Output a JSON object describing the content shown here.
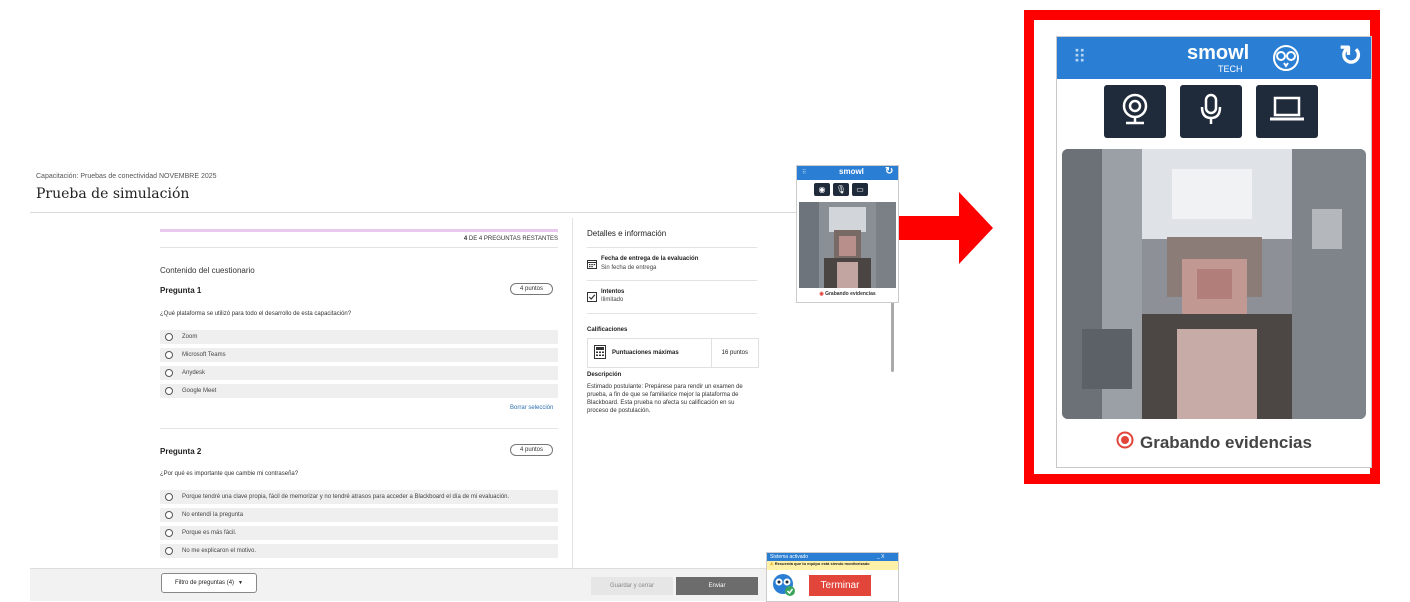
{
  "page": {
    "breadcrumb": "Capacitación: Pruebas de conectividad NOVEMBRE 2025",
    "title": "Prueba de simulación"
  },
  "progress": {
    "count": "4",
    "label": " DE 4 PREGUNTAS RESTANTES"
  },
  "quiz": {
    "heading": "Contenido del cuestionario",
    "clear_selection": "Borrar selección",
    "questions": [
      {
        "title": "Pregunta 1",
        "points": "4 puntos",
        "text": "¿Qué plataforma se utilizó para todo el desarrollo de esta capacitación?",
        "options": [
          "Zoom",
          "Microsoft Teams",
          "Anydesk",
          "Google Meet"
        ]
      },
      {
        "title": "Pregunta 2",
        "points": "4 puntos",
        "text": "¿Por qué es importante que cambie mi contraseña?",
        "options": [
          "Porque tendré una clave propia, fácil de memorizar y no tendré atrasos para acceder a Blackboard el día de mi evaluación.",
          "No entendí la pregunta",
          "Porque es más fácil.",
          "No me explicaron el motivo."
        ]
      }
    ]
  },
  "details": {
    "title": "Detalles e información",
    "due_label": "Fecha de entrega de la evaluación",
    "due_value": "Sin fecha de entrega",
    "attempts_label": "Intentos",
    "attempts_value": "Ilimitado",
    "grades_label": "Calificaciones",
    "max_points_label": "Puntuaciones máximas",
    "max_points_value": "16 puntos",
    "description_label": "Descripción",
    "description_text": "Estimado postulante: Prepárese para rendir un examen de prueba, a fin de que se familiarice mejor la plataforma de Blackboard. Esta prueba no afecta su calificación en su proceso de postulación."
  },
  "footer": {
    "filter": "Filtro de preguntas (4)",
    "save": "Guardar y cerrar",
    "send": "Enviar"
  },
  "proctor": {
    "brand": "smowl",
    "brand_sub": "TECH",
    "recording": "Grabando evidencias",
    "colors": {
      "header": "#2a7fd4",
      "button": "#1f2a3a",
      "record": "#e2453a",
      "frame": "#ff0000"
    }
  },
  "notification": {
    "title": "Sistema activado",
    "controls": "_ X",
    "message": "Recuerda que tu equipo está siendo monitorizado",
    "finish": "Terminar"
  }
}
